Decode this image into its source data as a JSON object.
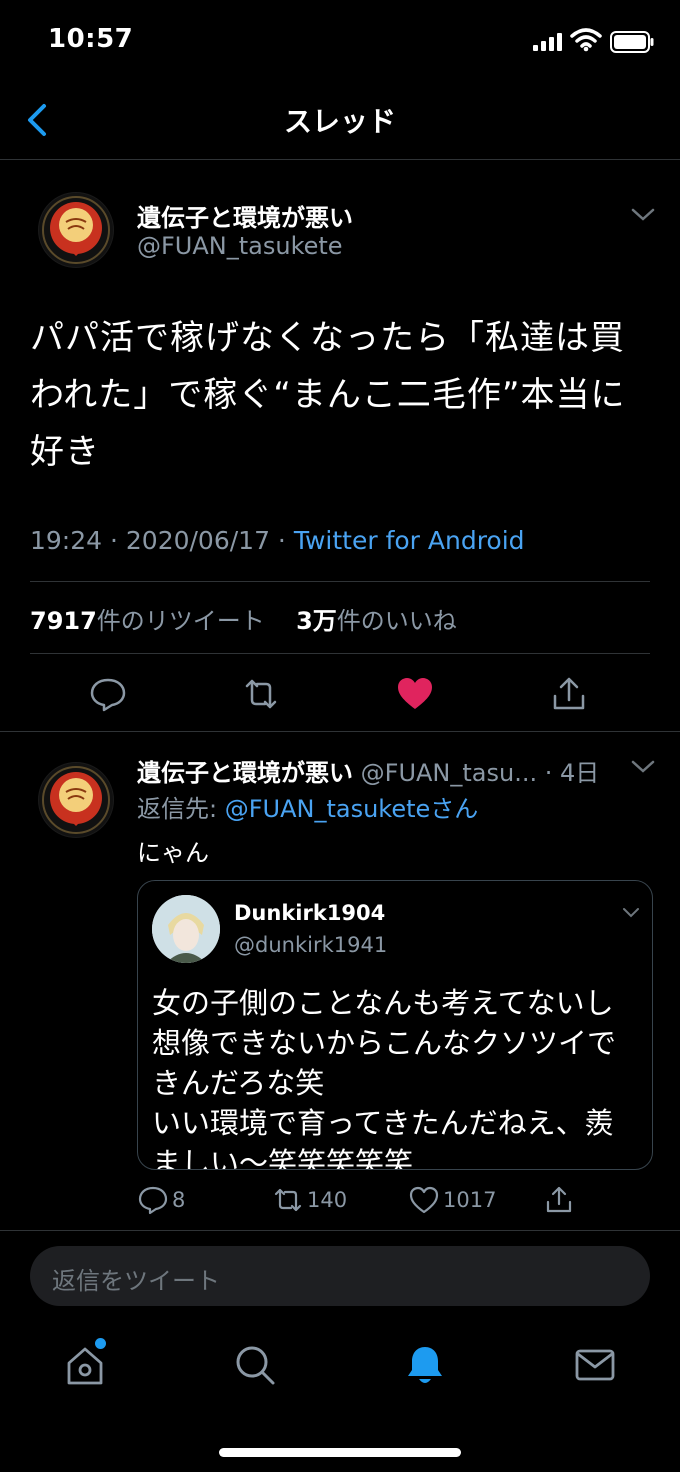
{
  "status_bar": {
    "time": "10:57"
  },
  "header": {
    "title": "スレッド"
  },
  "main_tweet": {
    "display_name": "遺伝子と環境が悪い",
    "handle": "@FUAN_tasukete",
    "text": "パパ活で稼げなくなったら「私達は買われた」で稼ぐ“まんこ二毛作”本当に好き",
    "time": "19:24",
    "date": "2020/06/17",
    "source": "Twitter for Android",
    "retweet_count": "7917",
    "retweet_label": "件のリツイート",
    "like_count": "3万",
    "like_label": "件のいいね",
    "liked": true,
    "like_color": "#e0245e"
  },
  "reply_tweet": {
    "display_name": "遺伝子と環境が悪い",
    "handle": "@FUAN_tasu...",
    "age": "4日",
    "replying_to_prefix": "返信先:",
    "replying_to": "@FUAN_tasuketeさん",
    "text": "にゃん",
    "quote": {
      "display_name": "Dunkirk1904",
      "handle": "@dunkirk1941",
      "text": "女の子側のことなんも考えてないし想像できないからこんなクソツイできんだろな笑\nいい環境で育ってきたんだねえ、羨ましい〜笑笑笑笑笑"
    },
    "reply_count": "8",
    "retweet_count": "140",
    "like_count": "1017"
  },
  "reply_box": {
    "placeholder": "返信をツイート"
  },
  "tab_bar": {
    "items": [
      "home-icon",
      "search-icon",
      "notifications-icon",
      "messages-icon"
    ],
    "active": "notifications-icon",
    "accent": "#1d9bf0"
  }
}
